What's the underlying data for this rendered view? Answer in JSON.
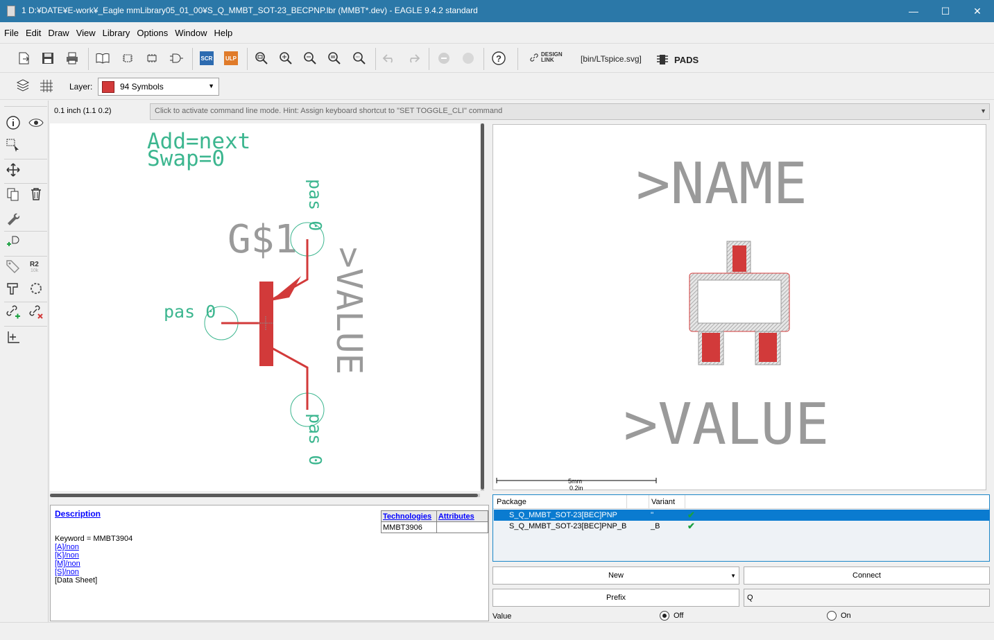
{
  "window": {
    "title": "1 D:¥DATE¥E-work¥_Eagle mmLibrary05_01_00¥S_Q_MMBT_SOT-23_BECPNP.lbr (MMBT*.dev) - EAGLE 9.4.2 standard",
    "minimize": "—",
    "maximize": "☐",
    "close": "✕"
  },
  "menu": [
    "File",
    "Edit",
    "Draw",
    "View",
    "Library",
    "Options",
    "Window",
    "Help"
  ],
  "toolbar": {
    "scr": "SCR",
    "ulp": "ULP",
    "design_link": "DESIGN LINK",
    "ltspice": "[bin/LTspice.svg]",
    "pads": "PADS",
    "help": "?"
  },
  "layerbar": {
    "label": "Layer:",
    "selected_layer": "94 Symbols",
    "layer_color": "#d23a3a"
  },
  "coordinates": "0.1 inch (1.1 0.2)",
  "command_line": {
    "placeholder": "Click to activate command line mode. Hint: Assign keyboard shortcut to \"SET TOGGLE_CLI\" command"
  },
  "symbol": {
    "addlevel": "Add=next",
    "swap": "Swap=0",
    "gate_name": "G$1",
    "value_label": ">VALUE",
    "pin_top": "pas 0",
    "pin_left": "pas 0",
    "pin_bottom": "pas 0",
    "text_color": "#3cb68f",
    "body_color": "#d23a3a"
  },
  "package": {
    "name_label": ">NAME",
    "value_label": ">VALUE",
    "scale_mm": "5mm",
    "scale_in": "0.2in"
  },
  "description": {
    "title": "Description",
    "keyword": "Keyword = MMBT3904",
    "links": [
      "[A]/non",
      "[K]/non",
      "[M]/non",
      "[S]/non"
    ],
    "datasheet": "[Data Sheet]"
  },
  "technologies": {
    "headers": [
      "Technologies",
      "Attributes"
    ],
    "rows": [
      [
        "MMBT3906",
        ""
      ]
    ]
  },
  "variants": {
    "headers": [
      "Package",
      "Variant"
    ],
    "rows": [
      {
        "package": "S_Q_MMBT_SOT-23[BEC]PNP",
        "variant": "''",
        "connected": "✔",
        "selected": true
      },
      {
        "package": "S_Q_MMBT_SOT-23[BEC]PNP_B",
        "variant": "_B",
        "connected": "✔",
        "selected": false
      }
    ]
  },
  "buttons": {
    "new": "New",
    "connect": "Connect",
    "prefix": "Prefix",
    "prefix_value": "Q"
  },
  "value_option": {
    "label": "Value",
    "off": "Off",
    "on": "On",
    "selected": "Off"
  }
}
